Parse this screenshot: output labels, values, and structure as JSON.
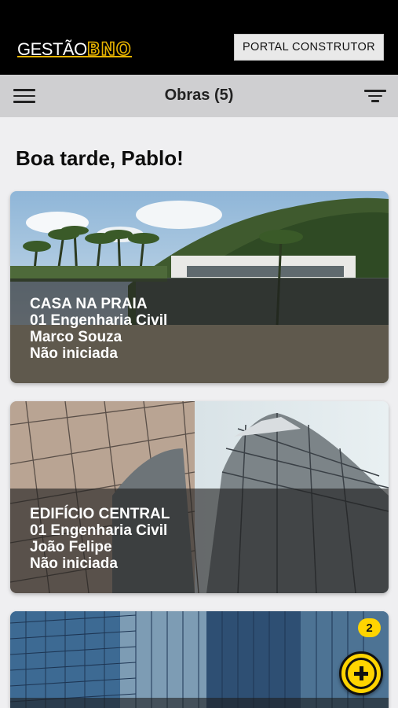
{
  "header": {
    "logo_part1": "GESTÃO",
    "logo_part2": "BNO",
    "portal_button": "PORTAL CONSTRUTOR"
  },
  "navbar": {
    "title": "Obras (5)",
    "menu_icon": "hamburger-menu-icon",
    "filter_icon": "filter-icon"
  },
  "greeting": "Boa tarde, Pablo!",
  "projects": [
    {
      "name": "CASA NA PRAIA",
      "discipline": "01 Engenharia Civil",
      "responsible": "Marco Souza",
      "status": "Não iniciada"
    },
    {
      "name": "EDIFÍCIO CENTRAL",
      "discipline": "01 Engenharia Civil",
      "responsible": "João Felipe",
      "status": "Não iniciada"
    }
  ],
  "fab": {
    "icon": "add-circle-icon",
    "badge": "2"
  },
  "colors": {
    "accent": "#ffd400",
    "header_bg": "#000000",
    "navbar_bg": "#cfcfd1"
  }
}
